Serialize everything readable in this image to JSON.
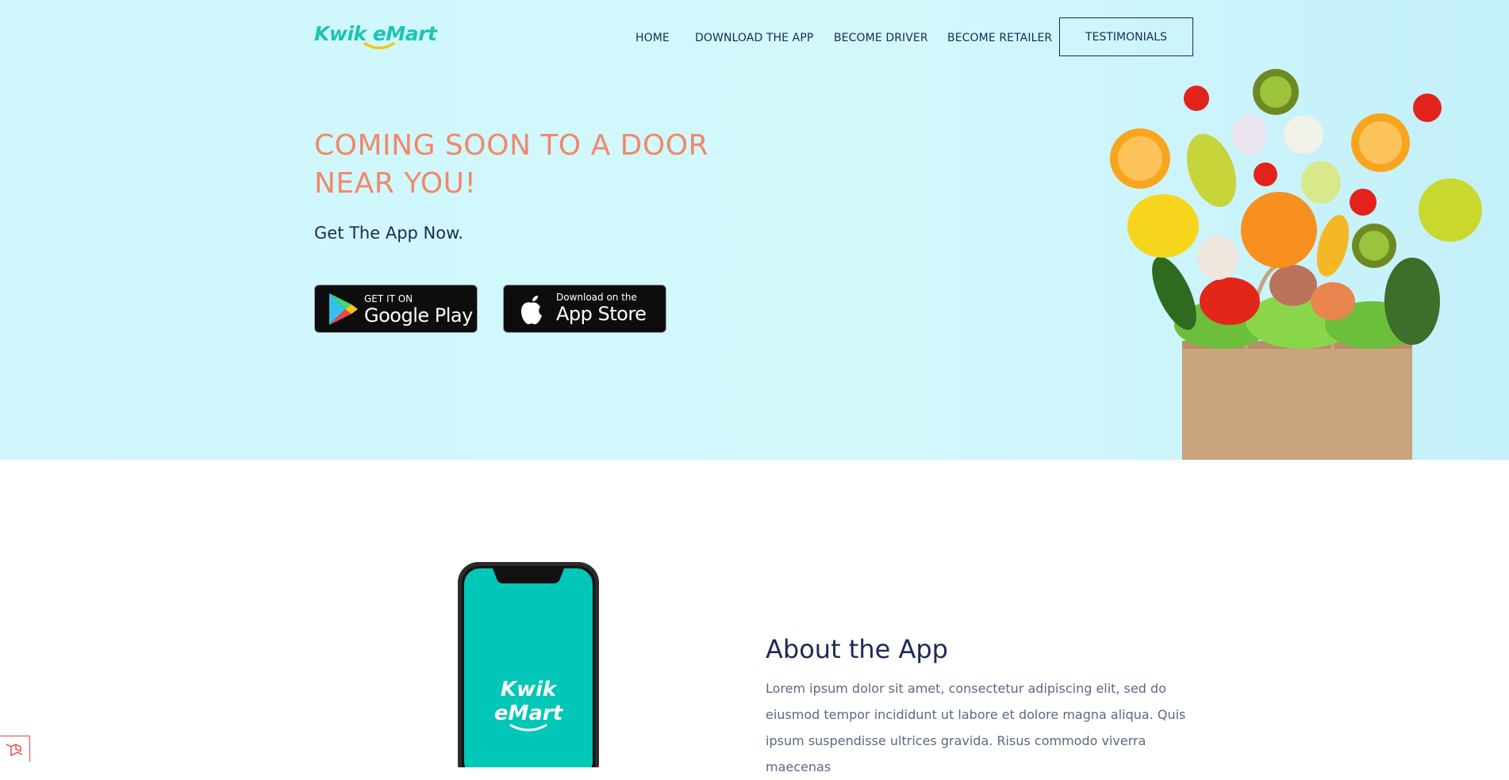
{
  "brand": {
    "logo_text": "Kwik eMart",
    "accent_color": "#1cc4b4"
  },
  "nav": {
    "home": "HOME",
    "download_app": "DOWNLOAD THE APP",
    "become_driver": "BECOME DRIVER",
    "become_retailer": "BECOME RETAILER",
    "testimonials": "TESTIMONIALS"
  },
  "hero": {
    "headline": "COMING SOON TO A DOOR NEAR YOU!",
    "subheadline": "Get The App Now.",
    "headline_color": "#f0896b",
    "google_play": {
      "small": "GET IT ON",
      "big": "Google Play"
    },
    "app_store": {
      "small": "Download on the",
      "big": "App Store"
    }
  },
  "phone": {
    "screen_logo_line1": "Kwik",
    "screen_logo_line2": "eMart"
  },
  "about": {
    "title": "About the App",
    "text": "Lorem ipsum dolor sit amet, consectetur adipiscing elit, sed do eiusmod tempor incididunt ut labore et dolore magna aliqua. Quis ipsum suspendisse ultrices gravida. Risus commodo viverra maecenas"
  }
}
